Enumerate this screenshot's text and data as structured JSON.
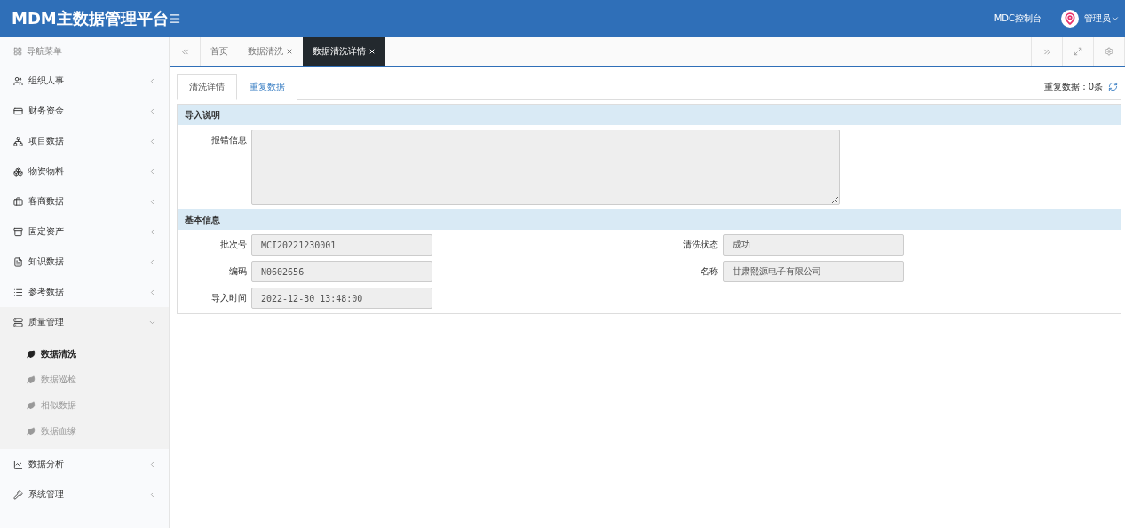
{
  "header": {
    "logo": "MDM主数据管理平台",
    "console_link": "MDC控制台",
    "user": "管理员"
  },
  "sidebar": {
    "title": "导航菜单",
    "items": [
      {
        "label": "组织人事",
        "expanded": false
      },
      {
        "label": "财务资金",
        "expanded": false
      },
      {
        "label": "项目数据",
        "expanded": false
      },
      {
        "label": "物资物料",
        "expanded": false
      },
      {
        "label": "客商数据",
        "expanded": false
      },
      {
        "label": "固定资产",
        "expanded": false
      },
      {
        "label": "知识数据",
        "expanded": false
      },
      {
        "label": "参考数据",
        "expanded": false
      },
      {
        "label": "质量管理",
        "expanded": true,
        "children": [
          {
            "label": "数据清洗",
            "selected": true
          },
          {
            "label": "数据巡检",
            "selected": false
          },
          {
            "label": "相似数据",
            "selected": false
          },
          {
            "label": "数据血缘",
            "selected": false
          }
        ]
      },
      {
        "label": "数据分析",
        "expanded": false
      },
      {
        "label": "系统管理",
        "expanded": false
      }
    ]
  },
  "page_tabs": [
    {
      "label": "首页",
      "closable": false,
      "selected": false
    },
    {
      "label": "数据清洗",
      "closable": true,
      "selected": false
    },
    {
      "label": "数据清洗详情",
      "closable": true,
      "selected": true
    }
  ],
  "content_tabs": [
    {
      "label": "清洗详情",
      "selected": true
    },
    {
      "label": "重复数据",
      "selected": false
    }
  ],
  "duplicate_count": "重复数据：0条",
  "sections": [
    {
      "title": "导入说明",
      "fields": [
        {
          "kind": "textarea",
          "label": "报错信息"
        }
      ]
    },
    {
      "title": "基本信息",
      "fields": [
        {
          "kind": "input",
          "label": "批次号",
          "value": "MCI20221230001"
        },
        {
          "kind": "input",
          "label": "清洗状态",
          "value": "成功"
        },
        {
          "kind": "input",
          "label": "编码",
          "value": "N0602656"
        },
        {
          "kind": "input",
          "label": "名称",
          "value": "甘肃熙源电子有限公司"
        },
        {
          "kind": "input",
          "label": "导入时间",
          "value": "2022-12-30 13:48:00"
        }
      ]
    }
  ]
}
